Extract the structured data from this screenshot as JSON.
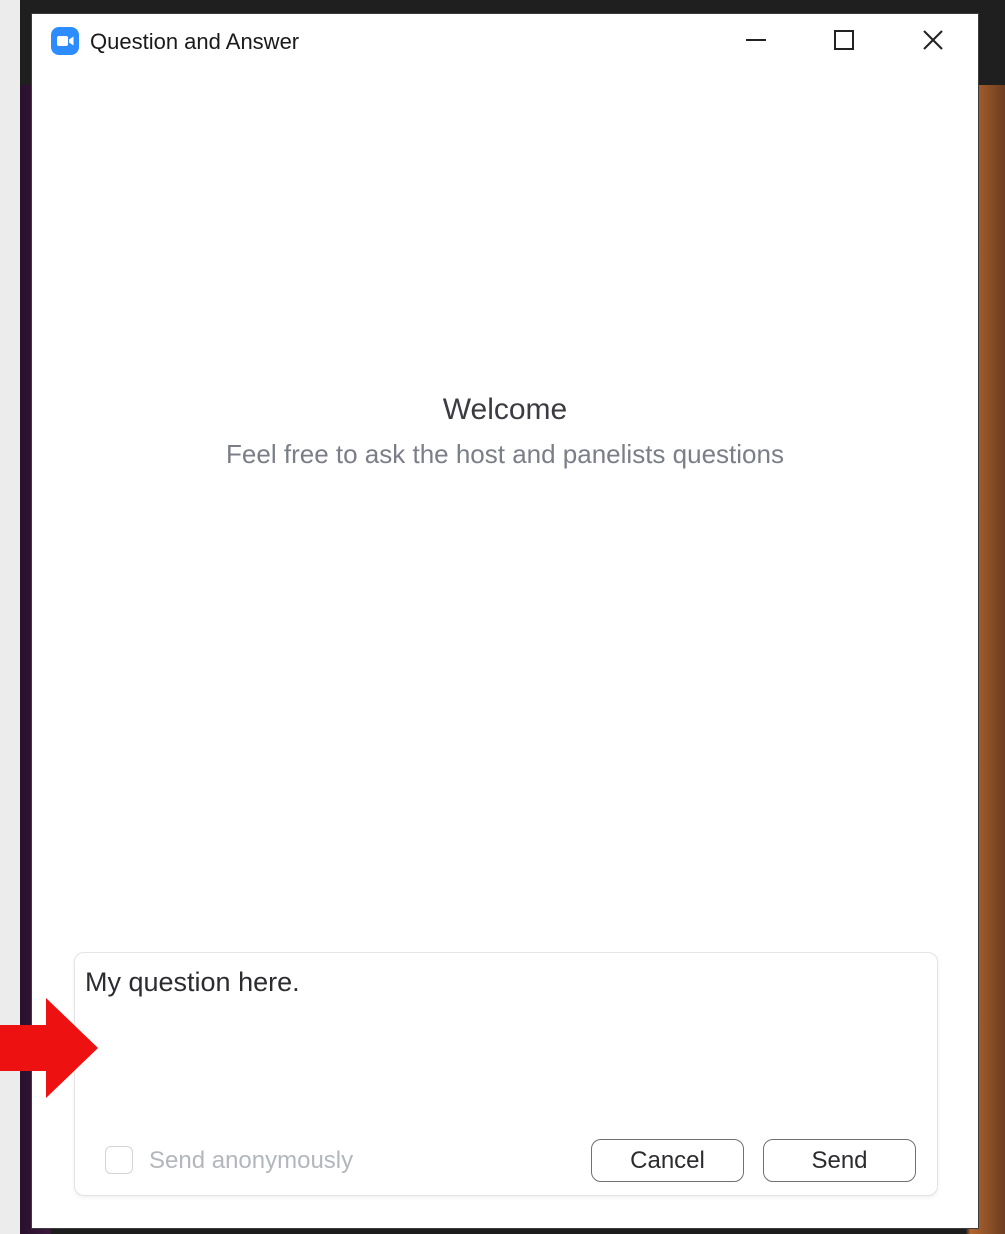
{
  "window": {
    "title": "Question and Answer",
    "icons": {
      "app": "zoom-video-icon",
      "minimize": "minimize-icon",
      "maximize": "maximize-icon",
      "close": "close-icon"
    },
    "accent_color": "#2D8CFF"
  },
  "welcome": {
    "title": "Welcome",
    "subtitle": "Feel free to ask the host and panelists questions"
  },
  "composer": {
    "question_value": "My question here.",
    "anonymous_label": "Send anonymously",
    "anonymous_checked": false,
    "cancel_label": "Cancel",
    "send_label": "Send"
  },
  "annotation": {
    "arrow_color": "#EE1111",
    "arrow_icon": "right-arrow-icon"
  }
}
